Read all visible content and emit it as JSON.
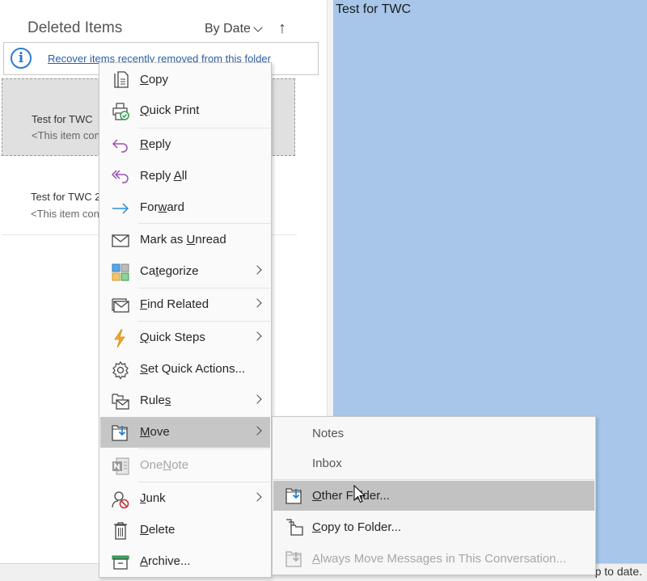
{
  "list_pane": {
    "folder_title": "Deleted Items",
    "sort_label": "By Date",
    "sort_direction_icon": "arrow-up-icon",
    "info_bar": {
      "icon": "info-icon",
      "icon_glyph": "i",
      "link_text": "Recover items recently removed from this folder"
    },
    "messages": [
      {
        "subject": "Test for TWC",
        "preview": "<This item contains active content",
        "selected": true
      },
      {
        "subject": "Test for TWC 2",
        "preview": "<This item contains active content",
        "selected": false
      }
    ]
  },
  "reading_pane": {
    "subject": "Test for TWC",
    "background": "#a7c6ea"
  },
  "status_bar": {
    "text": "p to date."
  },
  "context_menu": {
    "items": [
      {
        "pre": "",
        "key": "C",
        "post": "opy",
        "icon": "copy-icon"
      },
      {
        "pre": "",
        "key": "Q",
        "post": "uick Print",
        "icon": "quick-print-icon"
      },
      {
        "pre": "",
        "key": "R",
        "post": "eply",
        "icon": "reply-icon"
      },
      {
        "pre": "Reply ",
        "key": "A",
        "post": "ll",
        "icon": "reply-all-icon"
      },
      {
        "pre": "For",
        "key": "w",
        "post": "ard",
        "icon": "forward-icon"
      },
      {
        "pre": "Mark as ",
        "key": "U",
        "post": "nread",
        "icon": "envelope-icon"
      },
      {
        "pre": "Ca",
        "key": "t",
        "post": "egorize",
        "icon": "categorize-icon",
        "submenu": true
      },
      {
        "pre": "",
        "key": "F",
        "post": "ind Related",
        "icon": "find-related-icon",
        "submenu": true
      },
      {
        "pre": "",
        "key": "Q",
        "post": "uick Steps",
        "icon": "lightning-icon",
        "submenu": true
      },
      {
        "pre": "",
        "key": "S",
        "post": "et Quick Actions...",
        "icon": "gear-icon"
      },
      {
        "pre": "Rule",
        "key": "s",
        "post": "",
        "icon": "rules-icon",
        "submenu": true
      },
      {
        "pre": "",
        "key": "M",
        "post": "ove",
        "icon": "move-icon",
        "submenu": true,
        "highlighted": true
      },
      {
        "pre": "One",
        "key": "N",
        "post": "ote",
        "icon": "onenote-icon",
        "disabled": true
      },
      {
        "pre": "",
        "key": "J",
        "post": "unk",
        "icon": "junk-icon",
        "submenu": true
      },
      {
        "pre": "",
        "key": "D",
        "post": "elete",
        "icon": "trash-icon"
      },
      {
        "pre": "",
        "key": "A",
        "post": "rchive...",
        "icon": "archive-icon"
      }
    ]
  },
  "move_submenu": {
    "items": [
      {
        "label": "Notes",
        "type": "recent-folder"
      },
      {
        "label": "Inbox",
        "type": "recent-folder"
      },
      {
        "pre": "",
        "key": "O",
        "post": "ther Folder...",
        "icon": "move-to-folder-icon",
        "highlighted": true
      },
      {
        "pre": "",
        "key": "C",
        "post": "opy to Folder...",
        "icon": "copy-to-folder-icon"
      },
      {
        "pre": "",
        "key": "A",
        "post": "lways Move Messages in This Conversation...",
        "icon": "always-move-icon",
        "disabled": true
      }
    ]
  },
  "colors": {
    "accent_blue": "#2b7cd3",
    "link_blue": "#2b5ea8",
    "reply_purple": "#9b4fb0",
    "highlight_gray": "#c6c6c6"
  }
}
